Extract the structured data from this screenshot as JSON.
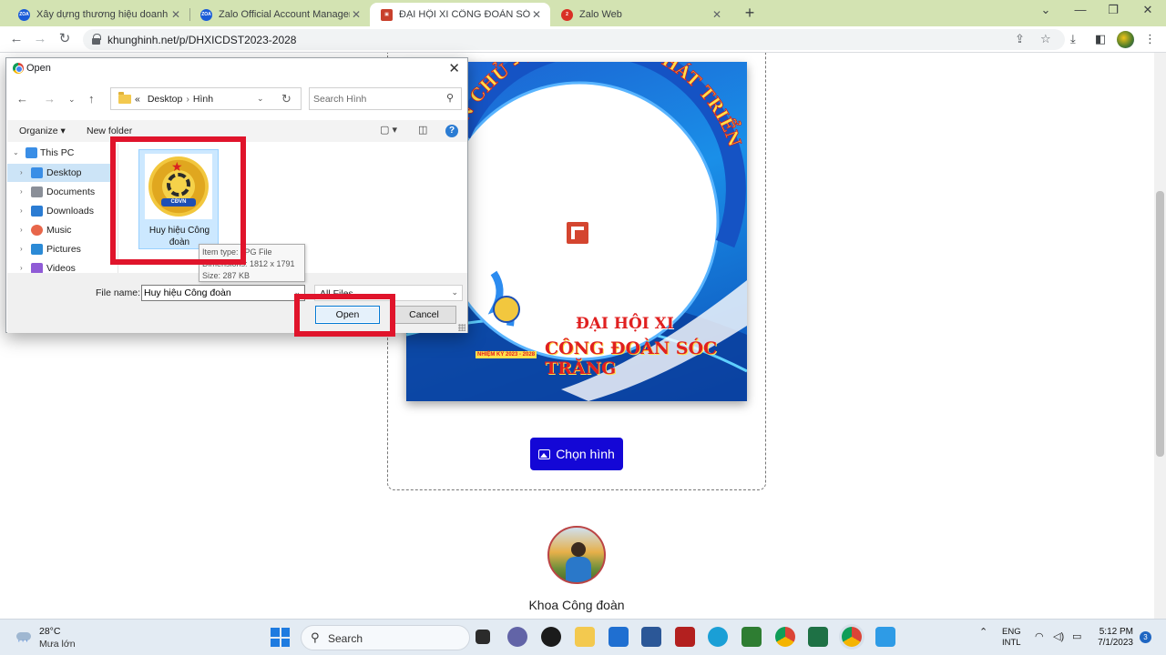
{
  "browser": {
    "tabs": [
      {
        "title": "Xây dựng thương hiệu doanh ng",
        "favicon_text": "ZOA",
        "favicon_color": "#1a5cd8"
      },
      {
        "title": "Zalo Official Account Manager",
        "favicon_text": "ZOA",
        "favicon_color": "#1a5cd8"
      },
      {
        "title": "ĐẠI HỘI XI CÔNG ĐOÀN SÓC TR",
        "favicon_text": "▣",
        "favicon_color": "#c8402c"
      },
      {
        "title": "Zalo Web",
        "favicon_text": "2",
        "favicon_color": "#d93025"
      }
    ],
    "new_tab": "+",
    "url": "khunghinh.net/p/DHXICDST2023-2028",
    "active_tab_index": 2
  },
  "page": {
    "poster": {
      "arc_text": "ÂN CHỦ - ĐOÀN KẾT - PHÁT TRIỂN",
      "line1": "ĐẠI HỘI XI",
      "line2": "CÔNG ĐOÀN SÓC TRĂNG",
      "term": "NHIỆM KỲ 2023 - 2028"
    },
    "pick_button": "Chọn hình",
    "author_name": "Khoa Công đoàn"
  },
  "dialog": {
    "title": "Open",
    "breadcrumb": [
      "Desktop",
      "Hình"
    ],
    "breadcrumb_prefix": "«",
    "search_placeholder": "Search Hình",
    "organize": "Organize ▾",
    "new_folder": "New folder",
    "tree": [
      {
        "label": "This PC",
        "icon_color": "#3a8ee6"
      },
      {
        "label": "Desktop",
        "icon_color": "#3a8ee6"
      },
      {
        "label": "Documents",
        "icon_color": "#8a8f98"
      },
      {
        "label": "Downloads",
        "icon_color": "#2b7cd3"
      },
      {
        "label": "Music",
        "icon_color": "#e8664a"
      },
      {
        "label": "Pictures",
        "icon_color": "#2b8ad6"
      },
      {
        "label": "Videos",
        "icon_color": "#8f5bd6"
      }
    ],
    "file": {
      "name": "Huy hiệu Công đoàn",
      "emblem_text": "CĐVN"
    },
    "tooltip": {
      "type": "Item type: JPG File",
      "dimensions": "Dimensions: 1812 x 1791",
      "size": "Size: 287 KB"
    },
    "file_name_label": "File name:",
    "file_name_value": "Huy hiệu Công đoàn",
    "file_type": "All Files",
    "open_button": "Open",
    "cancel_button": "Cancel",
    "highlight_color": "#e0142b"
  },
  "taskbar": {
    "temperature": "28°C",
    "condition": "Mưa lớn",
    "search_label": "Search",
    "lang_line1": "ENG",
    "lang_line2": "INTL",
    "time": "5:12 PM",
    "date": "7/1/2023",
    "notification_count": "3"
  }
}
